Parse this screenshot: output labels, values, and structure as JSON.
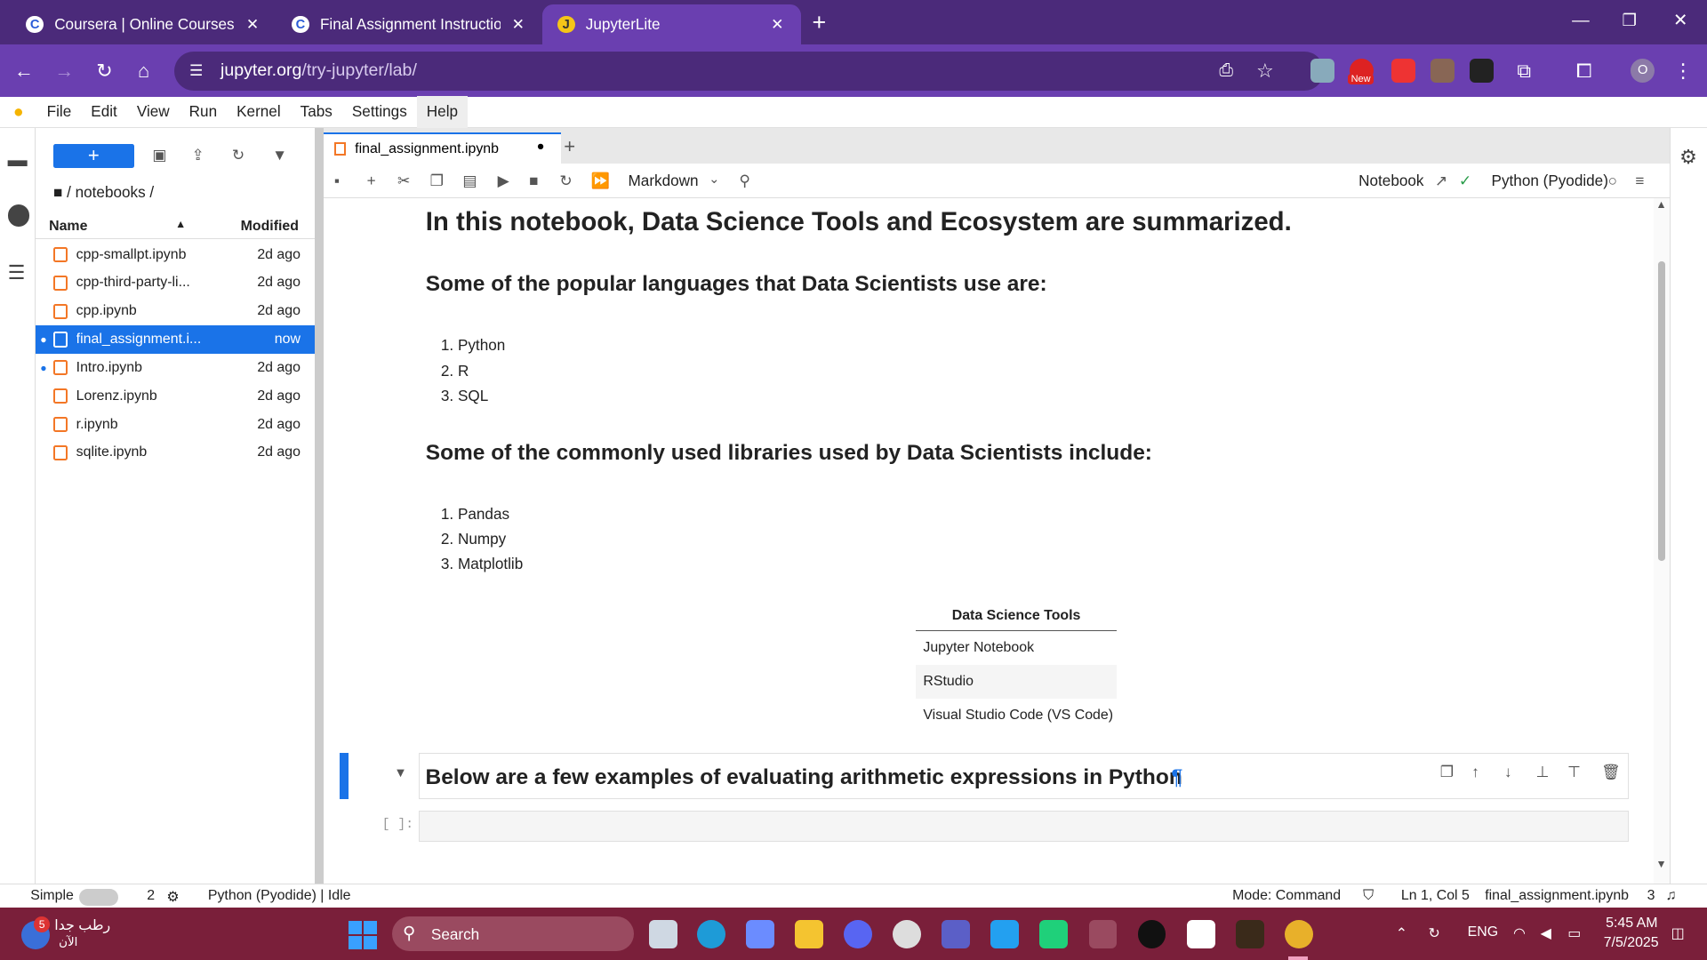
{
  "browser": {
    "tabs": [
      {
        "title": "Coursera | Online Courses From",
        "favicon": "C"
      },
      {
        "title": "Final Assignment Instructions: C",
        "favicon": "C"
      },
      {
        "title": "JupyterLite",
        "favicon": "J"
      }
    ],
    "new_tab": "+",
    "url_host": "jupyter.org",
    "url_path": "/try-jupyter/lab/",
    "ext_badge": "New",
    "profile": "O"
  },
  "menubar": [
    "File",
    "Edit",
    "View",
    "Run",
    "Kernel",
    "Tabs",
    "Settings",
    "Help"
  ],
  "filebrowser": {
    "breadcrumb": "/ notebooks /",
    "col_name": "Name",
    "col_modified": "Modified",
    "files": [
      {
        "name": "cpp-smallpt.ipynb",
        "modified": "2d ago"
      },
      {
        "name": "cpp-third-party-li...",
        "modified": "2d ago"
      },
      {
        "name": "cpp.ipynb",
        "modified": "2d ago"
      },
      {
        "name": "final_assignment.i...",
        "modified": "now"
      },
      {
        "name": "Intro.ipynb",
        "modified": "2d ago"
      },
      {
        "name": "Lorenz.ipynb",
        "modified": "2d ago"
      },
      {
        "name": "r.ipynb",
        "modified": "2d ago"
      },
      {
        "name": "sqlite.ipynb",
        "modified": "2d ago"
      }
    ]
  },
  "notebook": {
    "tab_title": "final_assignment.ipynb",
    "cell_type": "Markdown",
    "notebook_link": "Notebook",
    "kernel": "Python (Pyodide)",
    "title": "In this notebook, Data Science Tools and Ecosystem are summarized.",
    "languages_heading": "Some of the popular languages that Data Scientists use are:",
    "languages": [
      "1. Python",
      "2. R",
      "3. SQL"
    ],
    "libraries_heading": "Some of the commonly used libraries used by Data Scientists include:",
    "libraries": [
      "1. Pandas",
      "2. Numpy",
      "3. Matplotlib"
    ],
    "table_header": "Data Science Tools",
    "table_rows": [
      "Jupyter Notebook",
      "RStudio",
      "Visual Studio Code (VS Code)"
    ],
    "active_heading": "Below are a few examples of evaluating arithmetic expressions in Python",
    "pilcrow": "¶",
    "prompt": "[ ]:"
  },
  "status": {
    "mode_label": "Simple",
    "count": "2",
    "kernel_status": "Python (Pyodide) | Idle",
    "mode": "Mode: Command",
    "position": "Ln 1, Col 5",
    "file": "final_assignment.ipynb",
    "notifications": "3"
  },
  "taskbar": {
    "weather": "رطب جدا",
    "weather_sub": "الآن",
    "badge": "5",
    "search": "Search",
    "lang": "ENG",
    "time": "5:45 AM",
    "date": "7/5/2025"
  },
  "colors": {
    "accent": "#1a73e8",
    "chrome": "#6a3fb0",
    "taskbar": "#7a1f3a"
  }
}
